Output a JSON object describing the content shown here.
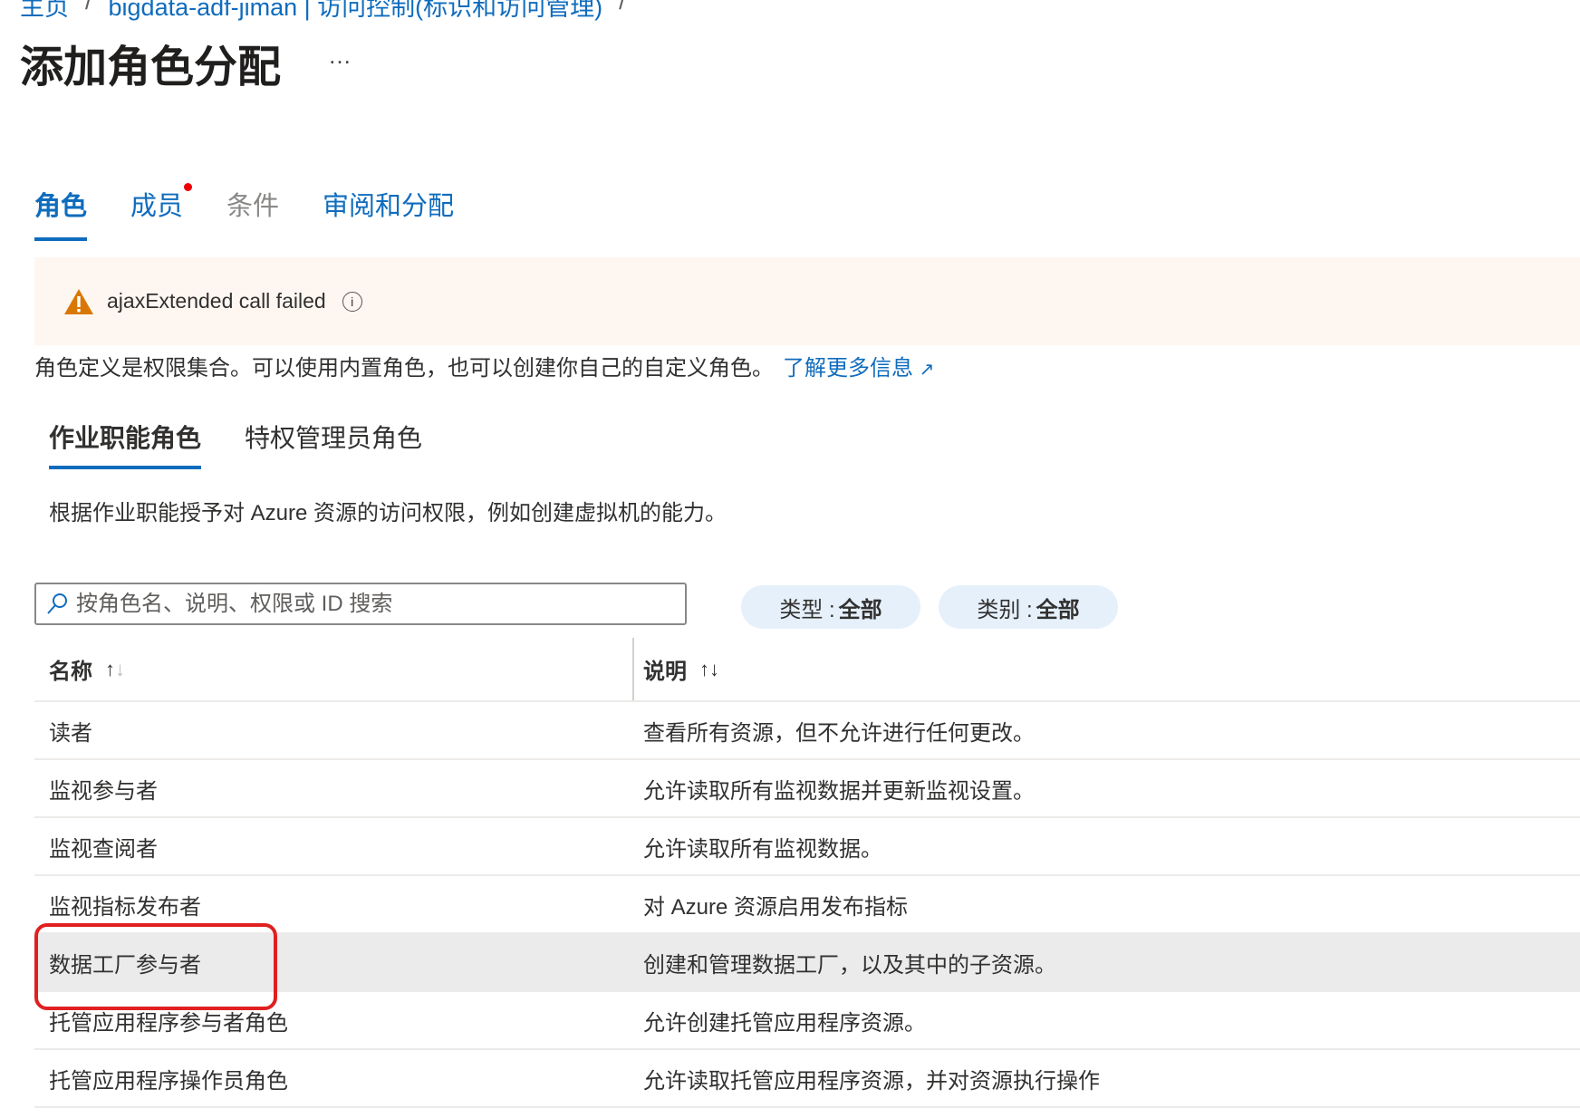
{
  "breadcrumb": [
    "主页",
    "bigdata-adf-jiman | 访问控制(标识和访问管理)"
  ],
  "page_title": "添加角色分配",
  "more_label": "…",
  "tabs": [
    {
      "label": "角色"
    },
    {
      "label": "成员"
    },
    {
      "label": "条件"
    },
    {
      "label": "审阅和分配"
    }
  ],
  "banner": {
    "message": "ajaxExtended call failed"
  },
  "description": {
    "text": "角色定义是权限集合。可以使用内置角色，也可以创建你自己的自定义角色。",
    "link": "了解更多信息"
  },
  "subtabs": [
    {
      "label": "作业职能角色"
    },
    {
      "label": "特权管理员角色"
    }
  ],
  "subtab_info": "根据作业职能授予对 Azure 资源的访问权限，例如创建虚拟机的能力。",
  "search": {
    "placeholder": "按角色名、说明、权限或 ID 搜索",
    "value": ""
  },
  "filters": [
    {
      "key": "类型 : ",
      "value": "全部"
    },
    {
      "key": "类别 : ",
      "value": "全部"
    }
  ],
  "table": {
    "headers": [
      "名称",
      "说明"
    ],
    "rows": [
      {
        "name": "读者",
        "desc": "查看所有资源，但不允许进行任何更改。"
      },
      {
        "name": "监视参与者",
        "desc": "允许读取所有监视数据并更新监视设置。"
      },
      {
        "name": "监视查阅者",
        "desc": "允许读取所有监视数据。"
      },
      {
        "name": "监视指标发布者",
        "desc": "对 Azure 资源启用发布指标"
      },
      {
        "name": "数据工厂参与者",
        "desc": "创建和管理数据工厂，以及其中的子资源。"
      },
      {
        "name": "托管应用程序参与者角色",
        "desc": "允许创建托管应用程序资源。"
      },
      {
        "name": "托管应用程序操作员角色",
        "desc": "允许读取托管应用程序资源，并对资源执行操作"
      }
    ]
  }
}
